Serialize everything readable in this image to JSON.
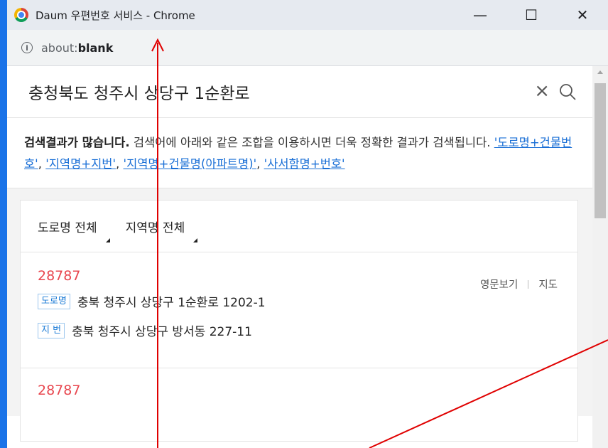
{
  "window": {
    "title": "Daum 우편번호 서비스 - Chrome",
    "minimize_glyph": "—",
    "maximize_glyph": "☐",
    "close_glyph": "✕"
  },
  "address_bar": {
    "info_glyph": "i",
    "url_prefix": "about:",
    "url_bold": "blank"
  },
  "search": {
    "value": "충청북도 청주시 상당구 1순환로",
    "clear_glyph": "×",
    "search_icon": "search-icon"
  },
  "notice": {
    "bold_text": "검색결과가 많습니다.",
    "text": " 검색어에 아래와 같은 조합을 이용하시면 더욱 정확한 결과가 검색됩니다.",
    "links": [
      "'도로명+건물번호'",
      "'지역명+지번'",
      "'지역명+건물명(아파트명)'",
      "'사서함명+번호'"
    ],
    "separator": ", "
  },
  "filters": {
    "road": "도로명 전체",
    "region": "지역명 전체"
  },
  "results": [
    {
      "zipcode": "28787",
      "english_link": "영문보기",
      "map_link": "지도",
      "road_badge": "도로명",
      "road_address": "충북 청주시 상당구 1순환로 1202-1",
      "jibun_badge": "지 번",
      "jibun_address": "충북 청주시 상당구 방서동 227-11"
    },
    {
      "zipcode": "28787"
    }
  ],
  "colors": {
    "background_blue": "#1a73e8",
    "zipcode_red": "#e8464e",
    "link_blue": "#1a6fd6",
    "annotation_red": "#e00000"
  }
}
